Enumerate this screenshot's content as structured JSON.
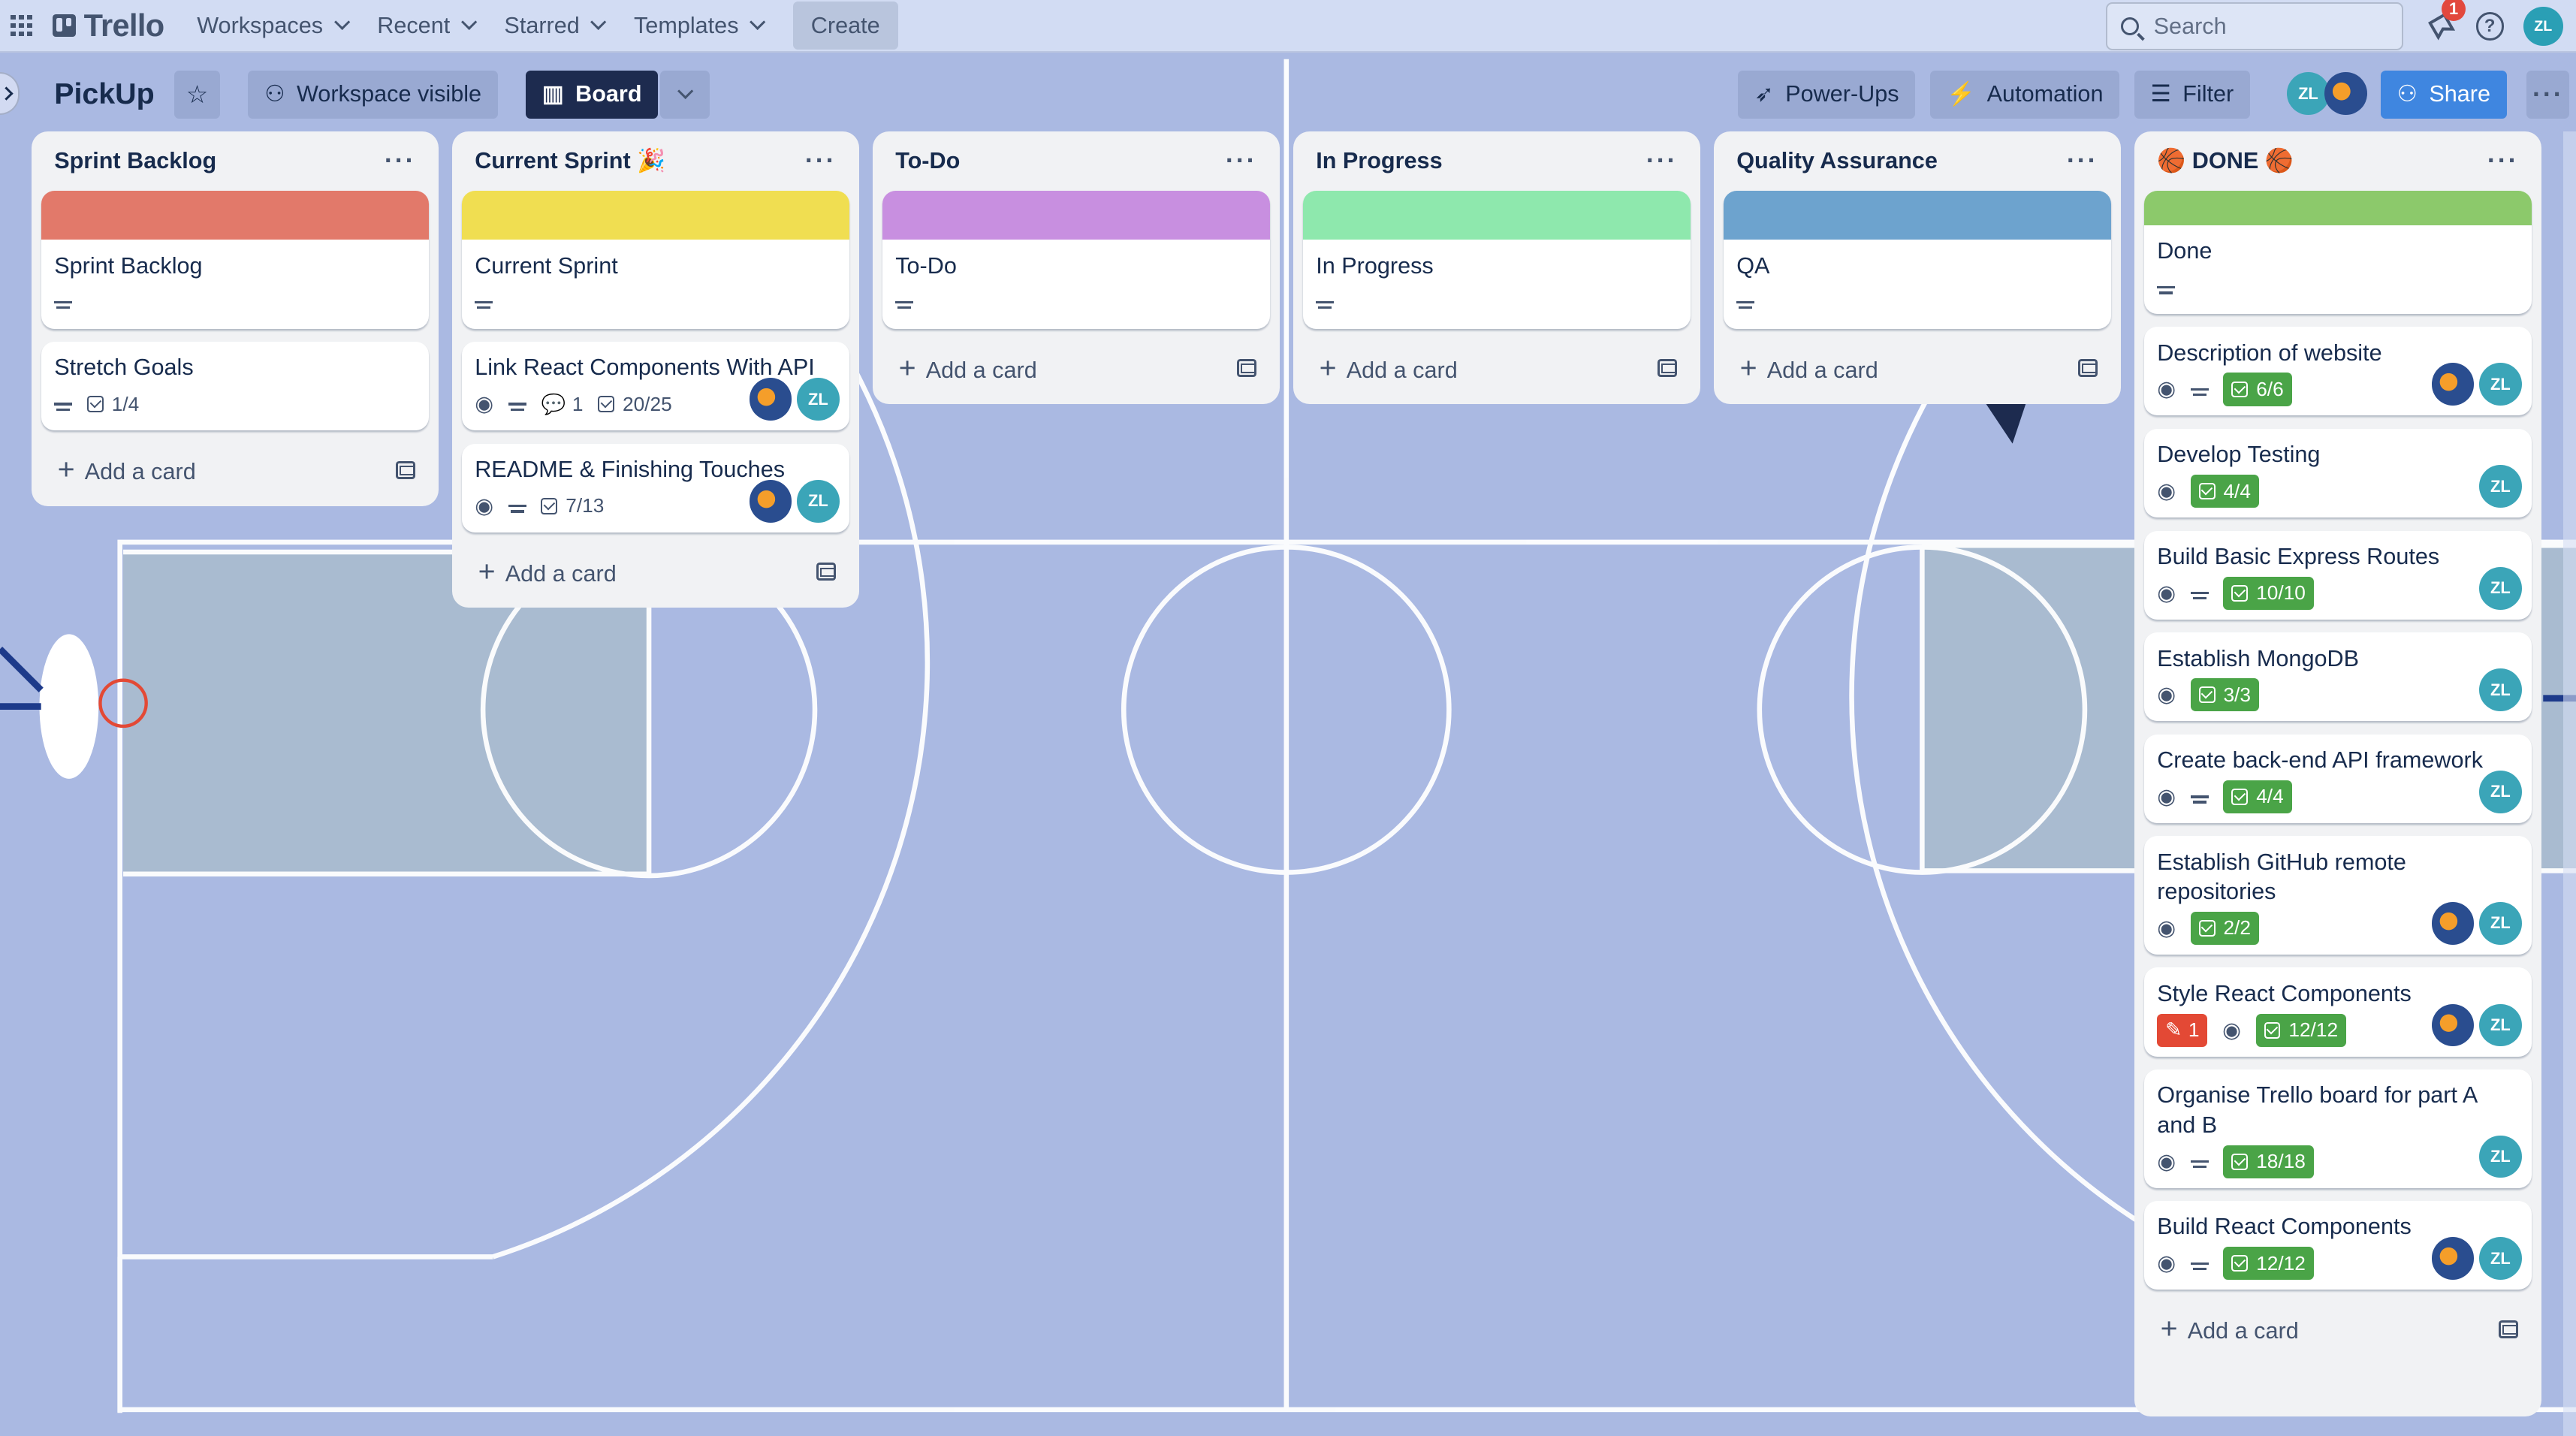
{
  "topnav": {
    "logo": "Trello",
    "menu": [
      {
        "label": "Workspaces"
      },
      {
        "label": "Recent"
      },
      {
        "label": "Starred"
      },
      {
        "label": "Templates"
      }
    ],
    "create_label": "Create",
    "search_placeholder": "Search",
    "notifications_count": "1",
    "user_initials": "ZL"
  },
  "board": {
    "title": "PickUp",
    "visibility_label": "Workspace visible",
    "view_label": "Board",
    "powerups_label": "Power-Ups",
    "automation_label": "Automation",
    "filter_label": "Filter",
    "share_label": "Share",
    "member_initials": "ZL"
  },
  "colors": {
    "sprint_backlog": "#e2796a",
    "current_sprint": "#f0de51",
    "todo": "#c88fe0",
    "in_progress": "#8ee8ad",
    "qa": "#6da3ce",
    "done": "#8cc96b"
  },
  "lists": {
    "sprint_backlog": {
      "title": "Sprint Backlog",
      "add_label": "Add a card",
      "cards": [
        {
          "title": "Sprint Backlog"
        },
        {
          "title": "Stretch Goals",
          "checklist": "1/4"
        }
      ]
    },
    "current_sprint": {
      "title": "Current Sprint 🎉",
      "add_label": "Add a card",
      "cards": [
        {
          "title": "Current Sprint"
        },
        {
          "title": "Link React Components With API",
          "comments": "1",
          "checklist": "20/25",
          "avatar": "ZL"
        },
        {
          "title": "README & Finishing Touches",
          "checklist": "7/13",
          "avatar": "ZL"
        }
      ]
    },
    "todo": {
      "title": "To-Do",
      "add_label": "Add a card",
      "cards": [
        {
          "title": "To-Do"
        }
      ]
    },
    "in_progress": {
      "title": "In Progress",
      "add_label": "Add a card",
      "cards": [
        {
          "title": "In Progress"
        }
      ]
    },
    "qa": {
      "title": "Quality Assurance",
      "add_label": "Add a card",
      "cards": [
        {
          "title": "QA"
        }
      ]
    },
    "done": {
      "title": "🏀 DONE 🏀",
      "add_label": "Add a card",
      "cards": [
        {
          "title": "Done"
        },
        {
          "title": "Description of website",
          "checklist": "6/6",
          "avatar": "ZL"
        },
        {
          "title": "Develop Testing",
          "checklist": "4/4",
          "avatar": "ZL"
        },
        {
          "title": "Build Basic Express Routes",
          "checklist": "10/10",
          "avatar": "ZL"
        },
        {
          "title": "Establish MongoDB",
          "checklist": "3/3",
          "avatar": "ZL"
        },
        {
          "title": "Create back-end API framework",
          "checklist": "4/4",
          "avatar": "ZL"
        },
        {
          "title": "Establish GitHub remote repositories",
          "checklist": "2/2",
          "avatar": "ZL"
        },
        {
          "title": "Style React Components",
          "votes": "1",
          "checklist": "12/12",
          "avatar": "ZL"
        },
        {
          "title": "Organise Trello board for part A and B",
          "checklist": "18/18",
          "avatar": "ZL"
        },
        {
          "title": "Build React Components",
          "checklist": "12/12",
          "avatar": "ZL"
        }
      ]
    }
  }
}
